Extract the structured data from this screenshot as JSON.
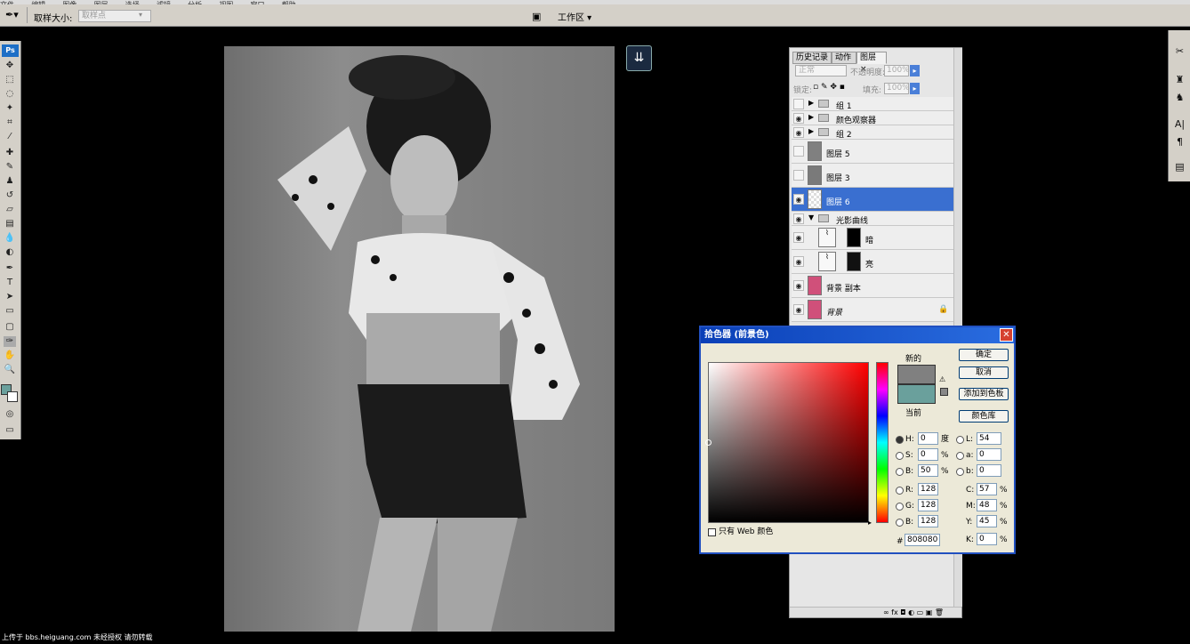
{
  "menubar": {
    "items": [
      "文件",
      "编辑",
      "图像",
      "图层",
      "选择",
      "滤镜",
      "分析",
      "视图",
      "窗口",
      "帮助"
    ]
  },
  "options": {
    "sample_size_label": "取样大小:",
    "sample_size_value": "取样点",
    "workspace_label": "工作区 ▾"
  },
  "toolbox": {
    "logo": "Ps"
  },
  "layers_panel": {
    "tabs": [
      "历史记录",
      "动作",
      "图层 ×"
    ],
    "blend_mode": "正常",
    "opacity_label": "不透明度:",
    "opacity_value": "100%",
    "lock_label": "锁定:",
    "fill_label": "填充:",
    "fill_value": "100%",
    "layers": [
      {
        "name": "组 1",
        "type": "group",
        "visible": false
      },
      {
        "name": "颜色观察器",
        "type": "group",
        "visible": true
      },
      {
        "name": "组 2",
        "type": "group",
        "visible": true
      },
      {
        "name": "图层 5",
        "type": "layer",
        "visible": false
      },
      {
        "name": "图层 3",
        "type": "layer",
        "visible": false
      },
      {
        "name": "图层 6",
        "type": "layer",
        "visible": true,
        "selected": true
      },
      {
        "name": "光影曲线",
        "type": "group-open",
        "visible": true
      },
      {
        "name": "暗",
        "type": "adjustment",
        "visible": true
      },
      {
        "name": "亮",
        "type": "adjustment",
        "visible": true
      },
      {
        "name": "背景 副本",
        "type": "layer",
        "visible": true
      },
      {
        "name": "背景",
        "type": "background",
        "visible": true
      }
    ]
  },
  "color_picker": {
    "title": "拾色器 (前景色)",
    "new_label": "新的",
    "current_label": "当前",
    "ok": "确定",
    "cancel": "取消",
    "add_swatch": "添加到色板",
    "libraries": "颜色库",
    "web_only": "只有 Web 颜色",
    "hsb": {
      "h": "0",
      "s": "0",
      "b": "50",
      "h_unit": "度",
      "s_unit": "%",
      "b_unit": "%"
    },
    "rgb": {
      "r": "128",
      "g": "128",
      "b": "128"
    },
    "lab": {
      "l": "54",
      "a": "0",
      "b": "0"
    },
    "cmyk": {
      "c": "57",
      "m": "48",
      "y": "45",
      "k": "0",
      "unit": "%"
    },
    "hex_label": "#",
    "hex": "808080",
    "new_color": "#808080",
    "current_color": "#6aa09c"
  },
  "footer": {
    "watermark": "上传于 bbs.heiguang.com 未经授权 请勿转载"
  }
}
